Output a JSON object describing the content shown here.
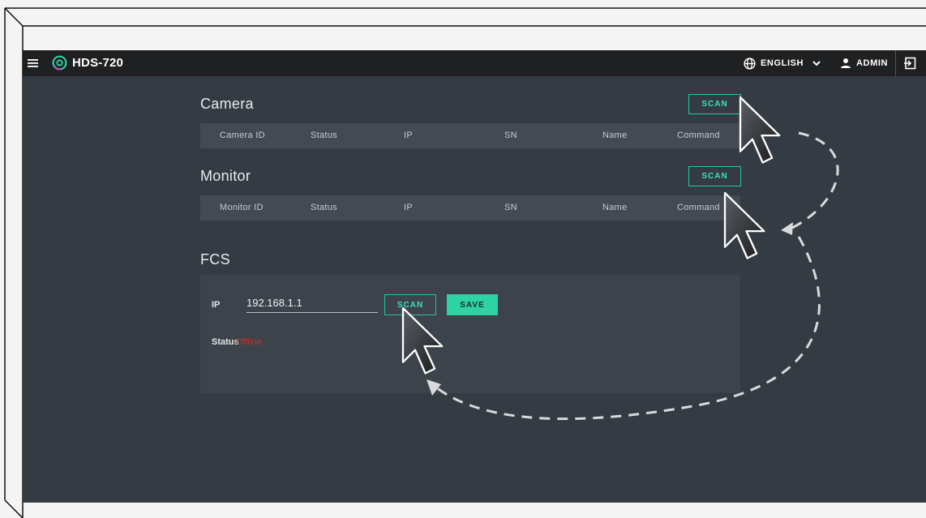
{
  "header": {
    "app_title": "HDS-720",
    "language": "ENGLISH",
    "user": "ADMIN"
  },
  "camera": {
    "title": "Camera",
    "scan_label": "SCAN",
    "columns": [
      "Camera ID",
      "Status",
      "IP",
      "SN",
      "Name",
      "Command"
    ]
  },
  "monitor": {
    "title": "Monitor",
    "scan_label": "SCAN",
    "columns": [
      "Monitor ID",
      "Status",
      "IP",
      "SN",
      "Name",
      "Command"
    ]
  },
  "fcs": {
    "title": "FCS",
    "ip_label": "IP",
    "ip_value": "192.168.1.1",
    "scan_label": "SCAN",
    "save_label": "SAVE",
    "status_label": "Status",
    "status_value": "Offline"
  },
  "colors": {
    "accent": "#2ed3a4",
    "status_offline": "#c8332b",
    "background": "#353b43"
  },
  "icons": [
    "hamburger-menu-icon",
    "logo-icon",
    "globe-icon",
    "chevron-down-icon",
    "user-icon",
    "logout-icon",
    "cursor-arrow-icon"
  ]
}
